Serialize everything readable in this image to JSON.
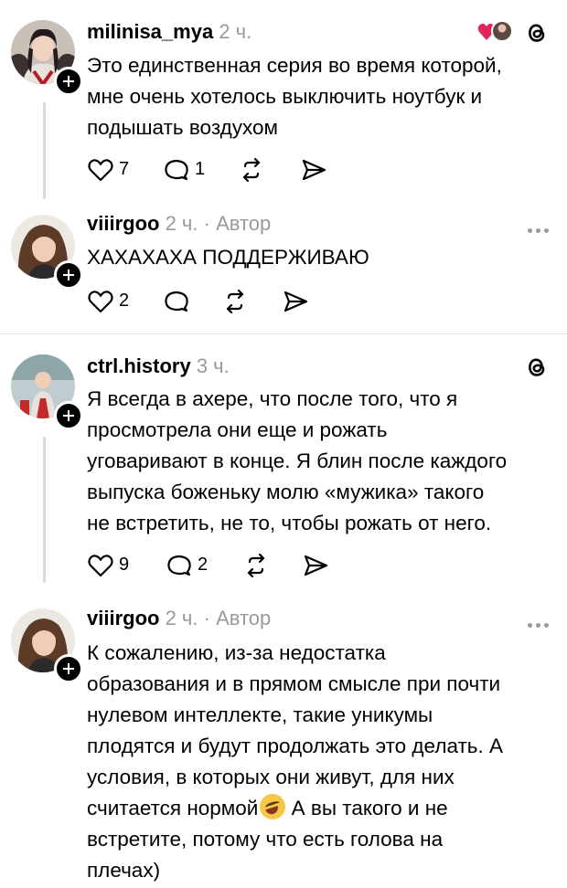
{
  "posts": [
    {
      "username": "milinisa_mya",
      "time": "2 ч.",
      "author_tag": "",
      "text_lines": [
        "Это единственная серия во время которой,",
        "мне очень хотелось выключить ноутбук и",
        "подышать воздухом"
      ],
      "likes": "7",
      "replies": "1",
      "top_right_icon": "threads-icon"
    },
    {
      "username": "viiirgoo",
      "time": "2 ч.",
      "author_tag": "· Автор",
      "text_lines": [
        "ХАХАХАХА ПОДДЕРЖИВАЮ"
      ],
      "likes": "2",
      "replies": "",
      "top_right_icon": "more-icon"
    },
    {
      "username": "ctrl.history",
      "time": "3 ч.",
      "author_tag": "",
      "text_lines": [
        "Я всегда в ахере, что после того, что я",
        "просмотрела они еще и рожать",
        "уговаривают в конце. Я блин после каждого",
        "выпуска боженьку молю «мужика» такого",
        "не встретить, не то, чтобы рожать от него."
      ],
      "likes": "9",
      "replies": "2",
      "top_right_icon": "threads-icon"
    },
    {
      "username": "viiirgoo",
      "time": "2 ч.",
      "author_tag": "· Автор",
      "text_lines": [
        "К сожалению, из-за недостатка",
        "образования и в прямом смысле при почти",
        "нулевом интеллекте, такие уникумы",
        "плодятся и будут продолжать это делать. А",
        "условия, в которых они живут, для них",
        "считается нормой",
        "встретите, потому что есть голова на",
        "плечах)"
      ],
      "line6_after_emoji": " А вы такого и не",
      "top_right_icon": "more-icon"
    }
  ],
  "colors": {
    "secondary_text": "#9a9a9a",
    "heart_accent": "#e0245e",
    "thread_line": "#d9d9d9"
  }
}
